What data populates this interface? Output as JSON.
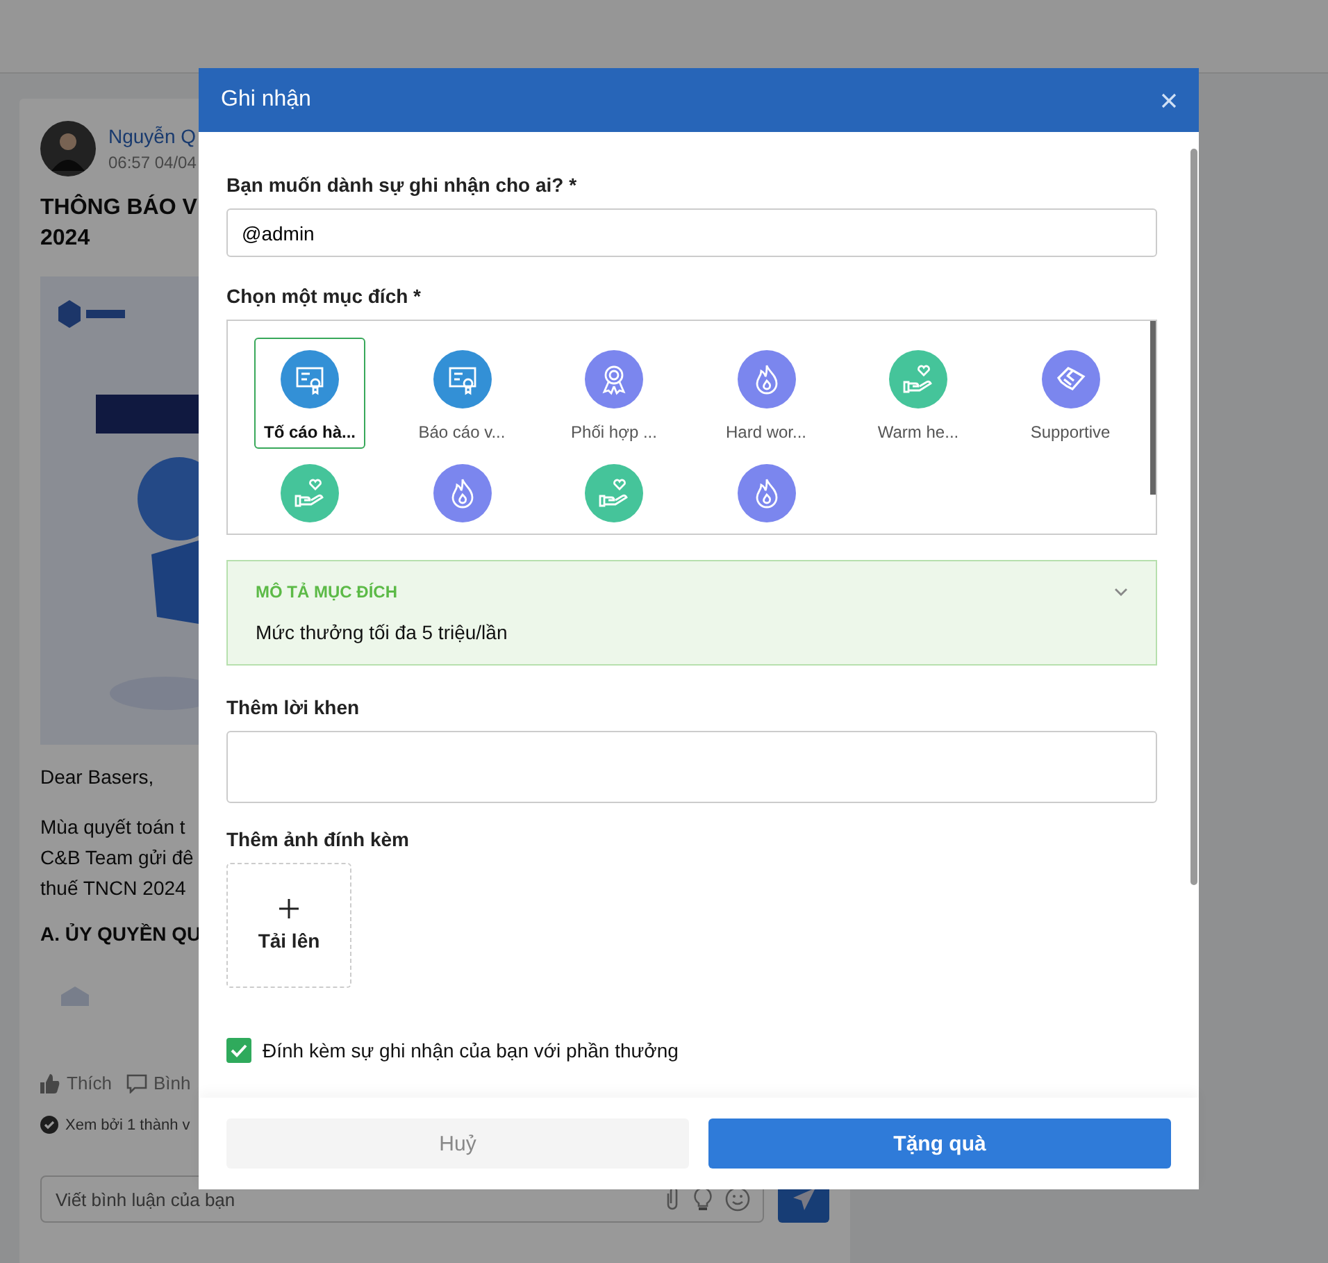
{
  "post": {
    "author": "Nguyễn Q",
    "time": "06:57 04/04",
    "title": [
      "THÔNG BÁO V",
      "2024"
    ],
    "paragraphs": [
      "Dear Basers,",
      "Mùa quyết toán t\nC&B Team gửi đê\nthuế TNCN 2024"
    ],
    "heading": "A. ỦY QUYỀN QU",
    "actions": [
      {
        "kind": "like",
        "label": "Thích"
      },
      {
        "kind": "comment",
        "label": "Bình"
      }
    ],
    "seen": "Xem bởi 1 thành v",
    "comment": {
      "placeholder": "Viết bình luận của bạn"
    }
  },
  "dialog": {
    "title": "Ghi nhận",
    "recipient": {
      "label": "Bạn muốn dành sự ghi nhận cho ai? *",
      "value": "@admin"
    },
    "purpose": {
      "label": "Chọn một mục đích *",
      "items": [
        {
          "label": "Tố cáo hà...",
          "kind": "certificate",
          "color": "#3390d6",
          "selected": true
        },
        {
          "label": "Báo cáo v...",
          "kind": "certificate",
          "color": "#3390d6",
          "selected": false
        },
        {
          "label": "Phối hợp ...",
          "kind": "medal",
          "color": "#7b86ee",
          "selected": false
        },
        {
          "label": "Hard wor...",
          "kind": "flame",
          "color": "#7b86ee",
          "selected": false
        },
        {
          "label": "Warm he...",
          "kind": "care",
          "color": "#45c49a",
          "selected": false
        },
        {
          "label": "Supportive",
          "kind": "handshake",
          "color": "#7b86ee",
          "selected": false
        },
        {
          "kind": "care",
          "color": "#45c49a",
          "selected": false
        },
        {
          "kind": "flame",
          "color": "#7b86ee",
          "selected": false
        },
        {
          "kind": "care",
          "color": "#45c49a",
          "selected": false
        },
        {
          "kind": "flame",
          "color": "#7b86ee",
          "selected": false
        }
      ]
    },
    "description": {
      "title": "MÔ TẢ MỤC ĐÍCH",
      "text": "Mức thưởng tối đa 5 triệu/lần",
      "expanded": true
    },
    "praise": {
      "label": "Thêm lời khen"
    },
    "attachment": {
      "label": "Thêm ảnh đính kèm",
      "upload": "Tải lên"
    },
    "attach_gift": {
      "label": "Đính kèm sự ghi nhận của bạn với phần thưởng",
      "checked": true
    },
    "buttons": [
      {
        "kind": "cancel",
        "label": "Huỷ"
      },
      {
        "kind": "primary",
        "label": "Tặng quà"
      }
    ]
  }
}
